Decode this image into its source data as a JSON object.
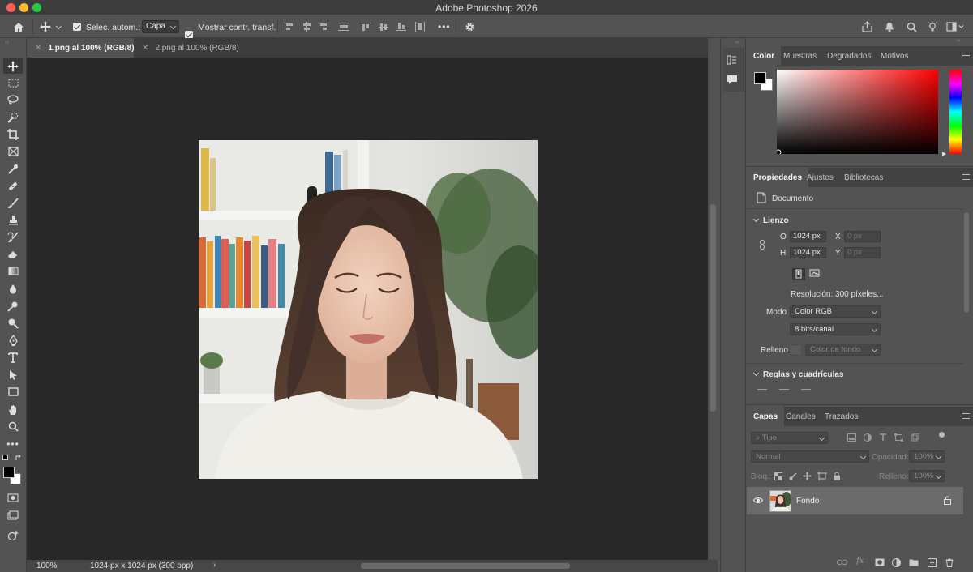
{
  "app": {
    "title": "Adobe Photoshop 2026"
  },
  "options_bar": {
    "auto_select_label": "Selec. autom.:",
    "auto_select_value": "Capa",
    "show_transform_label": "Mostrar contr. transf.",
    "more_label": "•••"
  },
  "documents": {
    "tabs": [
      {
        "label": "1.png al 100% (RGB/8)",
        "active": true
      },
      {
        "label": "2.png al 100% (RGB/8)",
        "active": false
      }
    ],
    "zoom": "100%",
    "status_info": "1024 px x 1024 px (300 ppp)"
  },
  "color_panel": {
    "tabs": [
      "Color",
      "Muestras",
      "Degradados",
      "Motivos"
    ],
    "foreground": "#000000",
    "background": "#ffffff"
  },
  "properties_panel": {
    "tabs": [
      "Propiedades",
      "Ajustes",
      "Bibliotecas"
    ],
    "document_label": "Documento",
    "canvas_section": "Lienzo",
    "width_label": "O",
    "width_value": "1024 px",
    "height_label": "H",
    "height_value": "1024 px",
    "x_label": "X",
    "x_placeholder": "0 px",
    "y_label": "Y",
    "y_placeholder": "0 px",
    "resolution": "Resolución: 300 píxeles...",
    "mode_label": "Modo",
    "mode_value": "Color RGB",
    "bits_value": "8 bits/canal",
    "fill_label": "Relleno",
    "fill_value": "Color de fondo",
    "rulers_section": "Reglas y cuadrículas"
  },
  "layers_panel": {
    "tabs": [
      "Capas",
      "Canales",
      "Trazados"
    ],
    "filter_placeholder": "Tipo",
    "blend_mode": "Normal",
    "opacity_label": "Opacidad:",
    "opacity_value": "100%",
    "lock_label": "Bloq.:",
    "fill_label": "Relleno:",
    "fill_value": "100%",
    "layers": [
      {
        "name": "Fondo",
        "visible": true,
        "locked": true
      }
    ]
  },
  "colors": {
    "accent": "#ffffff",
    "canvas_bg": "#282828",
    "panel_bg": "#535353"
  }
}
